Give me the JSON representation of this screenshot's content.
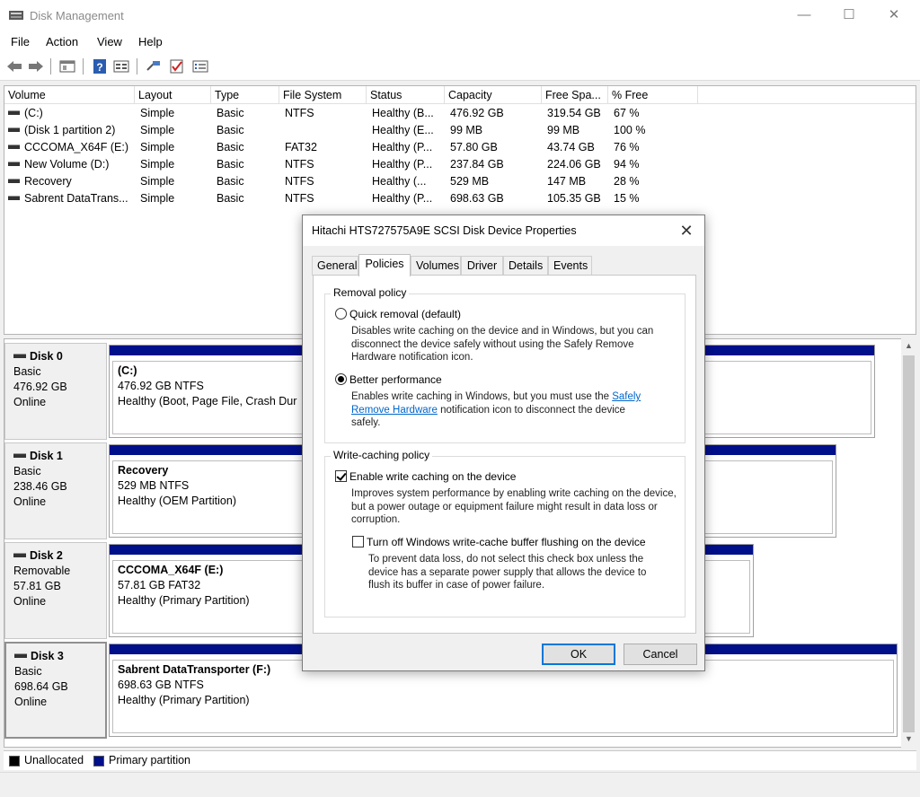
{
  "window": {
    "title": "Disk Management",
    "controls": {
      "minimize": "—",
      "maximize": "☐",
      "close": "✕"
    }
  },
  "menu": [
    "File",
    "Action",
    "View",
    "Help"
  ],
  "toolbar": {
    "icons": [
      "back-icon",
      "forward-icon",
      "list-view-icon",
      "help-icon",
      "properties-icon",
      "connect-icon",
      "checkmark-icon",
      "settings-icon"
    ]
  },
  "volume_list": {
    "columns": [
      "Volume",
      "Layout",
      "Type",
      "File System",
      "Status",
      "Capacity",
      "Free Spa...",
      "% Free"
    ],
    "rows": [
      [
        "(C:)",
        "Simple",
        "Basic",
        "NTFS",
        "Healthy (B...",
        "476.92 GB",
        "319.54 GB",
        "67 %"
      ],
      [
        "(Disk 1 partition 2)",
        "Simple",
        "Basic",
        "",
        "Healthy (E...",
        "99 MB",
        "99 MB",
        "100 %"
      ],
      [
        "CCCOMA_X64F (E:)",
        "Simple",
        "Basic",
        "FAT32",
        "Healthy (P...",
        "57.80 GB",
        "43.74 GB",
        "76 %"
      ],
      [
        "New Volume (D:)",
        "Simple",
        "Basic",
        "NTFS",
        "Healthy (P...",
        "237.84 GB",
        "224.06 GB",
        "94 %"
      ],
      [
        "Recovery",
        "Simple",
        "Basic",
        "NTFS",
        "Healthy (...",
        "529 MB",
        "147 MB",
        "28 %"
      ],
      [
        "Sabrent DataTrans...",
        "Simple",
        "Basic",
        "NTFS",
        "Healthy (P...",
        "698.63 GB",
        "105.35 GB",
        "15 %"
      ]
    ]
  },
  "disks": [
    {
      "name": "Disk 0",
      "type": "Basic",
      "size": "476.92 GB",
      "state": "Online",
      "partition": {
        "name": "(C:)",
        "detail": "476.92 GB NTFS",
        "status": "Healthy (Boot, Page File, Crash Dur"
      }
    },
    {
      "name": "Disk 1",
      "type": "Basic",
      "size": "238.46 GB",
      "state": "Online",
      "partition": {
        "name": "Recovery",
        "detail": "529 MB NTFS",
        "status": "Healthy (OEM Partition)"
      }
    },
    {
      "name": "Disk 2",
      "type": "Removable",
      "size": "57.81 GB",
      "state": "Online",
      "partition": {
        "name": "CCCOMA_X64F  (E:)",
        "detail": "57.81 GB FAT32",
        "status": "Healthy (Primary Partition)"
      }
    },
    {
      "name": "Disk 3",
      "type": "Basic",
      "size": "698.64 GB",
      "state": "Online",
      "partition": {
        "name": "Sabrent DataTransporter  (F:)",
        "detail": "698.63 GB NTFS",
        "status": "Healthy (Primary Partition)"
      }
    }
  ],
  "legend": {
    "unallocated": "Unallocated",
    "primary": "Primary partition",
    "unallocated_color": "#000000",
    "primary_color": "#000f8a"
  },
  "dialog": {
    "title": "Hitachi HTS727575A9E SCSI Disk Device Properties",
    "close": "✕",
    "tabs": [
      "General",
      "Policies",
      "Volumes",
      "Driver",
      "Details",
      "Events"
    ],
    "active_tab": "Policies",
    "removal_policy": {
      "title": "Removal policy",
      "quick_label": "Quick removal (default)",
      "quick_desc": "Disables write caching on the device and in Windows, but you can disconnect the device safely without using the Safely Remove Hardware notification icon.",
      "better_label": "Better performance",
      "better_desc_pre": "Enables write caching in Windows, but you must use the",
      "better_desc_link": "Safely Remove Hardware",
      "better_desc_post": "notification icon to disconnect the device safely.",
      "selected": "Better performance"
    },
    "write_caching": {
      "title": "Write-caching policy",
      "enable_label": "Enable write caching on the device",
      "enable_desc": "Improves system performance by enabling write caching on the device, but a power outage or equipment failure might result in data loss or corruption.",
      "enable_checked": true,
      "flush_label": "Turn off Windows write-cache buffer flushing on the device",
      "flush_desc": "To prevent data loss, do not select this check box unless the device has a separate power supply that allows the device to flush its buffer in case of power failure.",
      "flush_checked": false
    },
    "ok": "OK",
    "cancel": "Cancel"
  }
}
